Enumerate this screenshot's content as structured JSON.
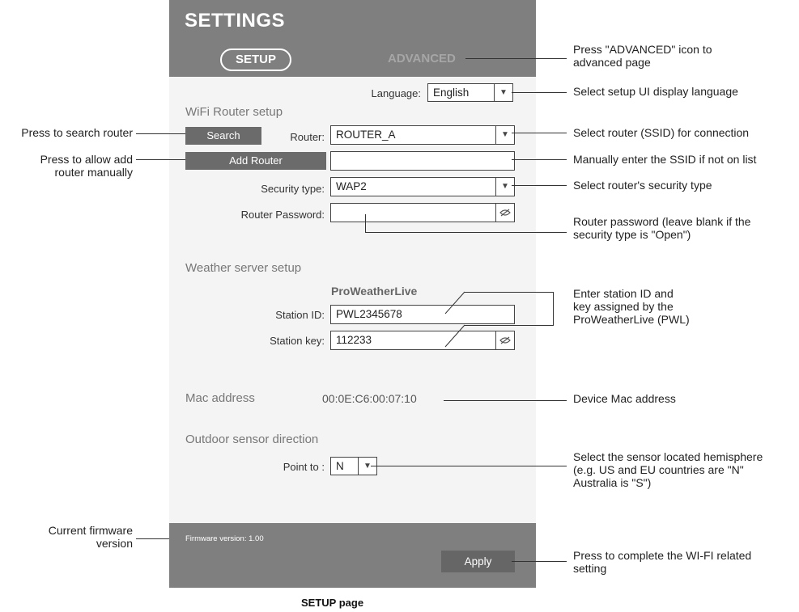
{
  "header": {
    "title": "SETTINGS",
    "tab_setup": "SETUP",
    "tab_advanced": "ADVANCED"
  },
  "language": {
    "label": "Language:",
    "value": "English"
  },
  "wifi": {
    "section_title": "WiFi Router setup",
    "search_button": "Search",
    "router_label": "Router:",
    "router_value": "ROUTER_A",
    "add_router_button": "Add Router",
    "manual_ssid_value": "",
    "security_label": "Security type:",
    "security_value": "WAP2",
    "password_label": "Router Password:",
    "password_value": ""
  },
  "weather": {
    "section_title": "Weather server setup",
    "provider": "ProWeatherLive",
    "station_id_label": "Station ID:",
    "station_id_value": "PWL2345678",
    "station_key_label": "Station key:",
    "station_key_value": "112233"
  },
  "mac": {
    "label": "Mac address",
    "value": "00:0E:C6:00:07:10"
  },
  "sensor": {
    "section_title": "Outdoor sensor direction",
    "point_label": "Point to :",
    "point_value": "N"
  },
  "footer": {
    "firmware": "Firmware version: 1.00",
    "apply_button": "Apply"
  },
  "annotations": {
    "advanced": [
      "Press \"ADVANCED\" icon to",
      "advanced page"
    ],
    "language": "Select setup UI display language",
    "search": "Press to search router",
    "add_router": [
      "Press to allow add",
      "router manually"
    ],
    "router": "Select router (SSID) for connection",
    "manual_ssid": "Manually enter the SSID if not on list",
    "security": "Select router's security type",
    "password": [
      "Router password (leave blank if the",
      "security type is \"Open\")"
    ],
    "station": [
      "Enter station ID and",
      "key assigned by the",
      "ProWeatherLive (PWL)"
    ],
    "mac": "Device Mac address",
    "sensor": [
      "Select the sensor located hemisphere",
      "(e.g. US and EU countries are \"N\"",
      "Australia is \"S\")"
    ],
    "firmware": [
      "Current firmware",
      "version"
    ],
    "apply": [
      "Press to complete the WI-FI related",
      "setting"
    ]
  },
  "caption": "SETUP page"
}
